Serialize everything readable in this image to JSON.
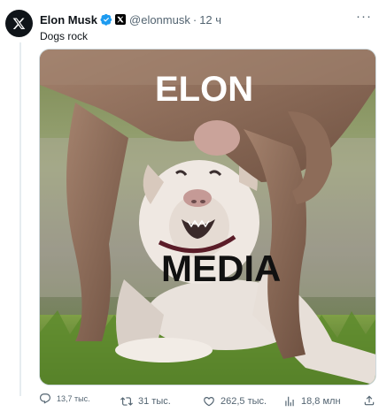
{
  "author": {
    "name": "Elon Musk",
    "handle": "@elonmusk",
    "time": "12 ч",
    "separator": "·",
    "more_label": "···"
  },
  "tweet": {
    "text": "Dogs rock"
  },
  "media": {
    "caption_top": "ELON",
    "caption_bottom": "MEDIA"
  },
  "actions": {
    "replies": "13,7 тыс.",
    "retweets": "31 тыс.",
    "likes": "262,5 тыс.",
    "views": "18,8 млн"
  },
  "colors": {
    "text": "#0f1419",
    "secondary": "#536471",
    "verified": "#1d9bf0"
  }
}
